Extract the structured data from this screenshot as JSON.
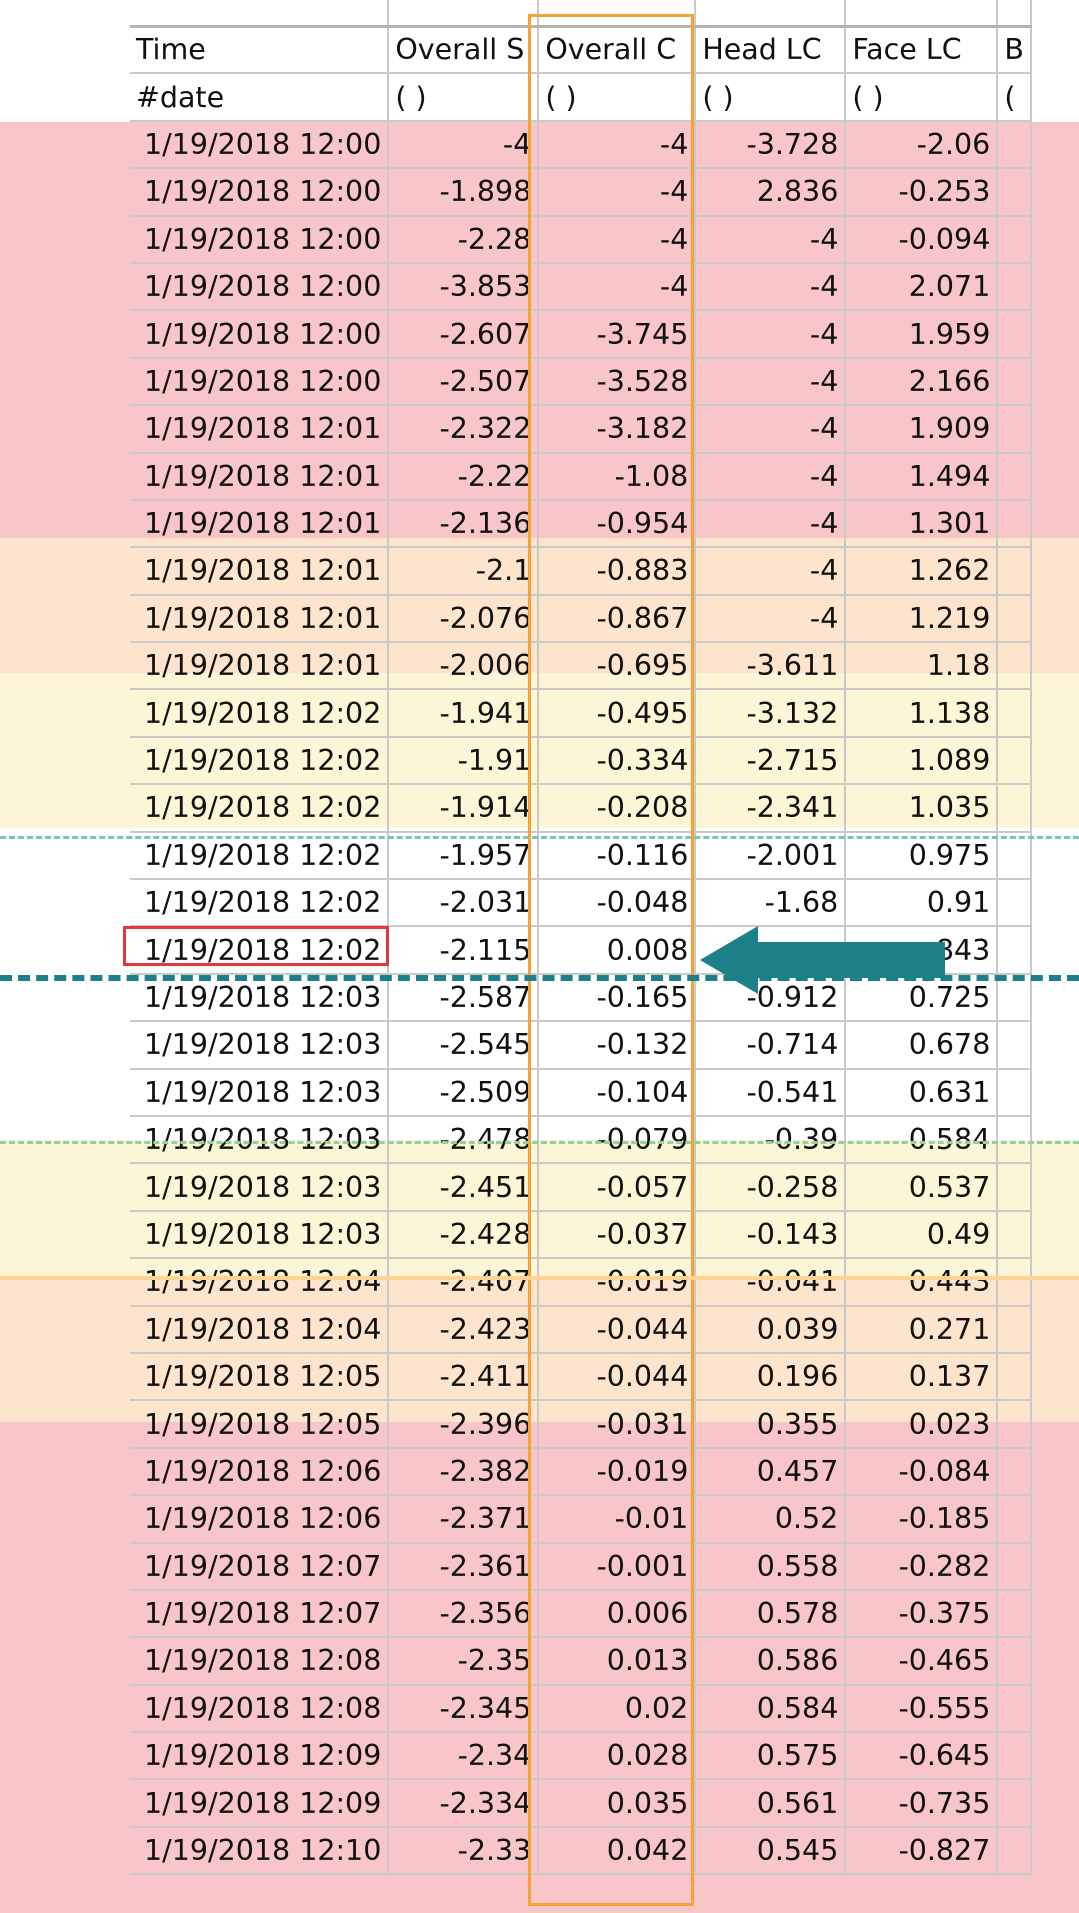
{
  "sheet": {
    "headers": [
      "Time",
      "Overall S",
      "Overall C",
      "Head LC",
      "Face LC",
      "B"
    ],
    "units": [
      "#date",
      "( )",
      "( )",
      "( )",
      "( )",
      "("
    ],
    "rows": [
      [
        "1/19/2018 12:00",
        "-4",
        "-4",
        "-3.728",
        "-2.06"
      ],
      [
        "1/19/2018 12:00",
        "-1.898",
        "-4",
        "2.836",
        "-0.253"
      ],
      [
        "1/19/2018 12:00",
        "-2.28",
        "-4",
        "-4",
        "-0.094"
      ],
      [
        "1/19/2018 12:00",
        "-3.853",
        "-4",
        "-4",
        "2.071"
      ],
      [
        "1/19/2018 12:00",
        "-2.607",
        "-3.745",
        "-4",
        "1.959"
      ],
      [
        "1/19/2018 12:00",
        "-2.507",
        "-3.528",
        "-4",
        "2.166"
      ],
      [
        "1/19/2018 12:01",
        "-2.322",
        "-3.182",
        "-4",
        "1.909"
      ],
      [
        "1/19/2018 12:01",
        "-2.22",
        "-1.08",
        "-4",
        "1.494"
      ],
      [
        "1/19/2018 12:01",
        "-2.136",
        "-0.954",
        "-4",
        "1.301"
      ],
      [
        "1/19/2018 12:01",
        "-2.1",
        "-0.883",
        "-4",
        "1.262"
      ],
      [
        "1/19/2018 12:01",
        "-2.076",
        "-0.867",
        "-4",
        "1.219"
      ],
      [
        "1/19/2018 12:01",
        "-2.006",
        "-0.695",
        "-3.611",
        "1.18"
      ],
      [
        "1/19/2018 12:02",
        "-1.941",
        "-0.495",
        "-3.132",
        "1.138"
      ],
      [
        "1/19/2018 12:02",
        "-1.91",
        "-0.334",
        "-2.715",
        "1.089"
      ],
      [
        "1/19/2018 12:02",
        "-1.914",
        "-0.208",
        "-2.341",
        "1.035"
      ],
      [
        "1/19/2018 12:02",
        "-1.957",
        "-0.116",
        "-2.001",
        "0.975"
      ],
      [
        "1/19/2018 12:02",
        "-2.031",
        "-0.048",
        "-1.68",
        "0.91"
      ],
      [
        "1/19/2018 12:02",
        "-2.115",
        "0.008",
        "",
        "843"
      ],
      [
        "1/19/2018 12:03",
        "-2.587",
        "-0.165",
        "-0.912",
        "0.725"
      ],
      [
        "1/19/2018 12:03",
        "-2.545",
        "-0.132",
        "-0.714",
        "0.678"
      ],
      [
        "1/19/2018 12:03",
        "-2.509",
        "-0.104",
        "-0.541",
        "0.631"
      ],
      [
        "1/19/2018 12:03",
        "-2.478",
        "-0.079",
        "-0.39",
        "0.584"
      ],
      [
        "1/19/2018 12:03",
        "-2.451",
        "-0.057",
        "-0.258",
        "0.537"
      ],
      [
        "1/19/2018 12:03",
        "-2.428",
        "-0.037",
        "-0.143",
        "0.49"
      ],
      [
        "1/19/2018 12:04",
        "-2.407",
        "-0.019",
        "-0.041",
        "0.443"
      ],
      [
        "1/19/2018 12:04",
        "-2.423",
        "-0.044",
        "0.039",
        "0.271"
      ],
      [
        "1/19/2018 12:05",
        "-2.411",
        "-0.044",
        "0.196",
        "0.137"
      ],
      [
        "1/19/2018 12:05",
        "-2.396",
        "-0.031",
        "0.355",
        "0.023"
      ],
      [
        "1/19/2018 12:06",
        "-2.382",
        "-0.019",
        "0.457",
        "-0.084"
      ],
      [
        "1/19/2018 12:06",
        "-2.371",
        "-0.01",
        "0.52",
        "-0.185"
      ],
      [
        "1/19/2018 12:07",
        "-2.361",
        "-0.001",
        "0.558",
        "-0.282"
      ],
      [
        "1/19/2018 12:07",
        "-2.356",
        "0.006",
        "0.578",
        "-0.375"
      ],
      [
        "1/19/2018 12:08",
        "-2.35",
        "0.013",
        "0.586",
        "-0.465"
      ],
      [
        "1/19/2018 12:08",
        "-2.345",
        "0.02",
        "0.584",
        "-0.555"
      ],
      [
        "1/19/2018 12:09",
        "-2.34",
        "0.028",
        "0.575",
        "-0.645"
      ],
      [
        "1/19/2018 12:09",
        "-2.334",
        "0.035",
        "0.561",
        "-0.735"
      ],
      [
        "1/19/2018 12:10",
        "-2.33",
        "0.042",
        "0.545",
        "-0.827"
      ]
    ]
  },
  "colors": {
    "zone_red": "#f8c6c8",
    "zone_orange": "#fde4cc",
    "zone_yellow": "#fcf6d6",
    "column_highlight": "#f7a234",
    "cell_highlight": "#e0383e",
    "arrow": "#1b8088",
    "dashed_line_center": "#1b8088",
    "dashed_line_upper": "#79c5be",
    "dashed_line_lower": "#8fd3a0",
    "line_orange": "#ffd494"
  }
}
